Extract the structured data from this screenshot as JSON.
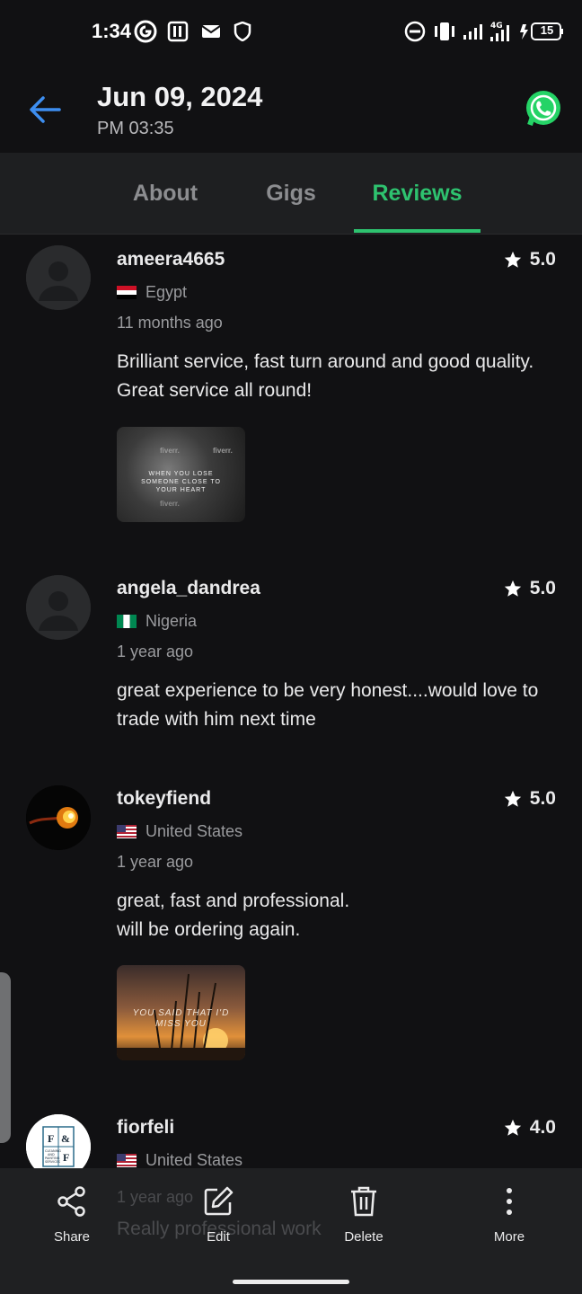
{
  "status_bar": {
    "time": "1:34",
    "battery": "15"
  },
  "header": {
    "title": "Jun 09, 2024",
    "subtitle": "PM 03:35",
    "back_icon": "arrow-left-icon",
    "share_app_icon": "whatsapp-icon"
  },
  "tabs": [
    {
      "label": "About",
      "active": false
    },
    {
      "label": "Gigs",
      "active": false
    },
    {
      "label": "Reviews",
      "active": true
    }
  ],
  "reviews": [
    {
      "username": "ameera4665",
      "rating": "5.0",
      "country": "Egypt",
      "time_ago": "11 months ago",
      "text": "Brilliant service, fast turn around and good quality. Great service all round!",
      "attachment": {
        "watermark": "fiverr.",
        "caption_lines": [
          "WHEN YOU LOSE",
          "SOMEONE CLOSE TO",
          "YOUR HEART"
        ]
      }
    },
    {
      "username": "angela_dandrea",
      "rating": "5.0",
      "country": "Nigeria",
      "time_ago": "1 year ago",
      "text": "great experience to be very honest....would love to trade with him next time"
    },
    {
      "username": "tokeyfiend",
      "rating": "5.0",
      "country": "United States",
      "time_ago": "1 year ago",
      "text_lines": [
        "great, fast and professional.",
        "will be ordering again."
      ],
      "attachment": {
        "caption_lines": [
          "YOU SAID THAT I'D",
          "MISS YOU"
        ]
      }
    },
    {
      "username": "fiorfeli",
      "rating": "4.0",
      "country": "United States",
      "time_ago": "1 year ago",
      "text": "Really professional work",
      "avatar_logo": {
        "letters": [
          "F",
          "&",
          "F"
        ],
        "small_text": [
          "CLEANING",
          "AND",
          "PAINTING",
          "SERVICES"
        ]
      }
    }
  ],
  "bottom_bar": [
    {
      "label": "Share",
      "icon": "share-icon"
    },
    {
      "label": "Edit",
      "icon": "edit-icon"
    },
    {
      "label": "Delete",
      "icon": "trash-icon"
    },
    {
      "label": "More",
      "icon": "more-vertical-icon"
    }
  ],
  "colors": {
    "accent": "#2ec26f",
    "back_arrow": "#3d8ef0",
    "background": "#111113",
    "whatsapp": "#25d366"
  }
}
